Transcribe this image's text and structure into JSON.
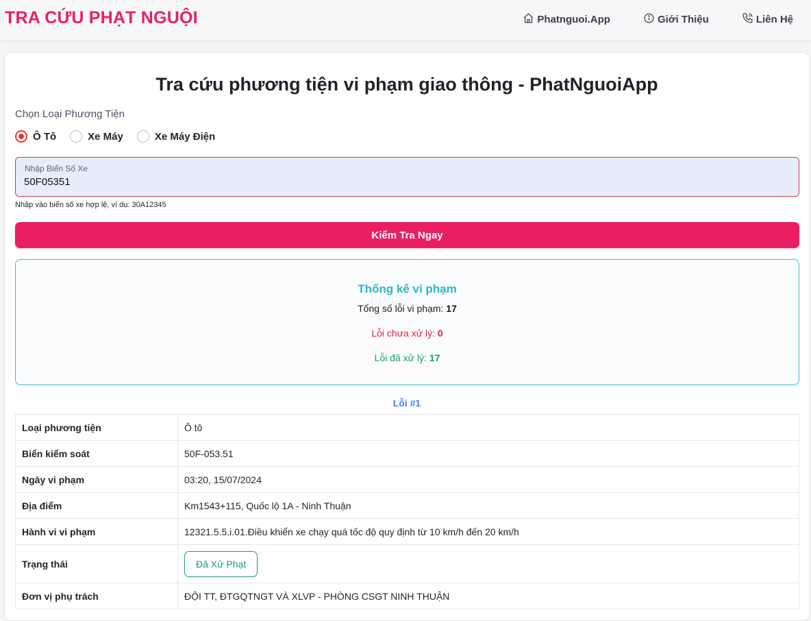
{
  "header": {
    "brand": "TRA CỨU PHẠT NGUỘI",
    "nav": [
      {
        "label": "Phatnguoi.App",
        "icon": "home-icon"
      },
      {
        "label": "Giới Thiệu",
        "icon": "info-icon"
      },
      {
        "label": "Liên Hệ",
        "icon": "phone-icon"
      }
    ]
  },
  "main": {
    "title": "Tra cứu phương tiện vi phạm giao thông - PhatNguoiApp",
    "choose_label": "Chọn Loại Phương Tiện",
    "vehicle_types": [
      {
        "label": "Ô Tô",
        "checked": true
      },
      {
        "label": "Xe Máy",
        "checked": false
      },
      {
        "label": "Xe Máy Điện",
        "checked": false
      }
    ],
    "plate": {
      "label": "Nhập Biển Số Xe",
      "value": "50F05351",
      "helper": "Nhập vào biển số xe hợp lệ, ví dụ: 30A12345"
    },
    "check_button": "Kiểm Tra Ngay",
    "stats": {
      "title": "Thống kê vi phạm",
      "total_label": "Tổng số lỗi vi phạm: ",
      "total_value": "17",
      "unpaid_label": "Lỗi chưa xử lý: ",
      "unpaid_value": "0",
      "paid_label": "Lỗi đã xử lý: ",
      "paid_value": "17"
    },
    "violation_heading": "Lỗi #1",
    "violation": {
      "rows": [
        {
          "key": "Loại phương tiện",
          "value": "Ô tô"
        },
        {
          "key": "Biển kiểm soát",
          "value": "50F-053.51"
        },
        {
          "key": "Ngày vi phạm",
          "value": "03:20, 15/07/2024"
        },
        {
          "key": "Địa điểm",
          "value": "Km1543+115, Quốc lộ 1A - Ninh Thuận"
        },
        {
          "key": "Hành vi vi phạm",
          "value": "12321.5.5.i.01.Điều khiển xe chạy quá tốc độ quy định từ 10 km/h đến 20 km/h"
        }
      ],
      "status_key": "Trạng thái",
      "status_value": "Đã Xử Phạt",
      "unit_key": "Đơn vị phụ trách",
      "unit_value": "ĐỘI TT, ĐTGQTNGT VÀ XLVP - PHÒNG CSGT NINH THUẬN"
    }
  },
  "colors": {
    "brand": "#e91e63",
    "button": "#ea1f63",
    "stats_title": "#2bb7c4",
    "unpaid": "#d7263d",
    "paid": "#1f9d63",
    "link": "#4a7ff0"
  }
}
